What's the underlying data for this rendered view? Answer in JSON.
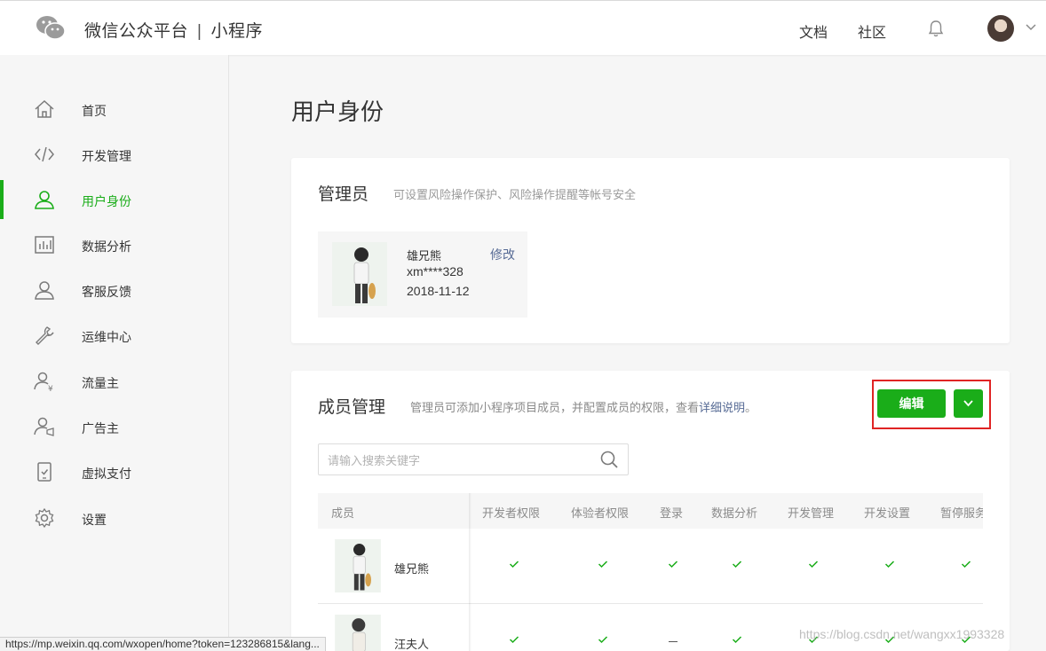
{
  "header": {
    "brand": "微信公众平台",
    "separator": "|",
    "product": "小程序",
    "links": [
      "文档",
      "社区"
    ]
  },
  "sidebar": {
    "items": [
      {
        "label": "首页",
        "icon": "home-icon"
      },
      {
        "label": "开发管理",
        "icon": "code-icon"
      },
      {
        "label": "用户身份",
        "icon": "user-icon",
        "active": true
      },
      {
        "label": "数据分析",
        "icon": "chart-icon"
      },
      {
        "label": "客服反馈",
        "icon": "service-icon"
      },
      {
        "label": "运维中心",
        "icon": "wrench-icon"
      },
      {
        "label": "流量主",
        "icon": "traffic-user-icon"
      },
      {
        "label": "广告主",
        "icon": "advertiser-icon"
      },
      {
        "label": "虚拟支付",
        "icon": "phone-pay-icon"
      },
      {
        "label": "设置",
        "icon": "gear-icon"
      }
    ],
    "active_color": "#1aad19"
  },
  "page": {
    "title": "用户身份"
  },
  "admin_card": {
    "title": "管理员",
    "desc": "可设置风险操作保护、风险操作提醒等帐号安全",
    "name": "雄兄熊",
    "edit_label": "修改",
    "account": "xm****328",
    "date": "2018-11-12"
  },
  "members_card": {
    "title": "成员管理",
    "desc_prefix": "管理员可添加小程序项目成员，并配置成员的权限，查看",
    "desc_link": "详细说明",
    "desc_suffix": "。",
    "edit_button": "编辑",
    "search_placeholder": "请输入搜索关键字",
    "columns": [
      "成员",
      "开发者权限",
      "体验者权限",
      "登录",
      "数据分析",
      "开发管理",
      "开发设置",
      "暂停服务"
    ],
    "rows": [
      {
        "name": "雄兄熊",
        "perms": [
          true,
          true,
          true,
          true,
          true,
          true,
          true
        ]
      },
      {
        "name": "汪夫人",
        "perms": [
          true,
          true,
          false,
          true,
          true,
          true,
          true
        ]
      }
    ]
  },
  "status_url": "https://mp.weixin.qq.com/wxopen/home?token=123286815&lang...",
  "watermark": "https://blog.csdn.net/wangxx1993328",
  "colors": {
    "accent": "#1aad19",
    "link": "#576b95",
    "highlight": "#e02424"
  }
}
